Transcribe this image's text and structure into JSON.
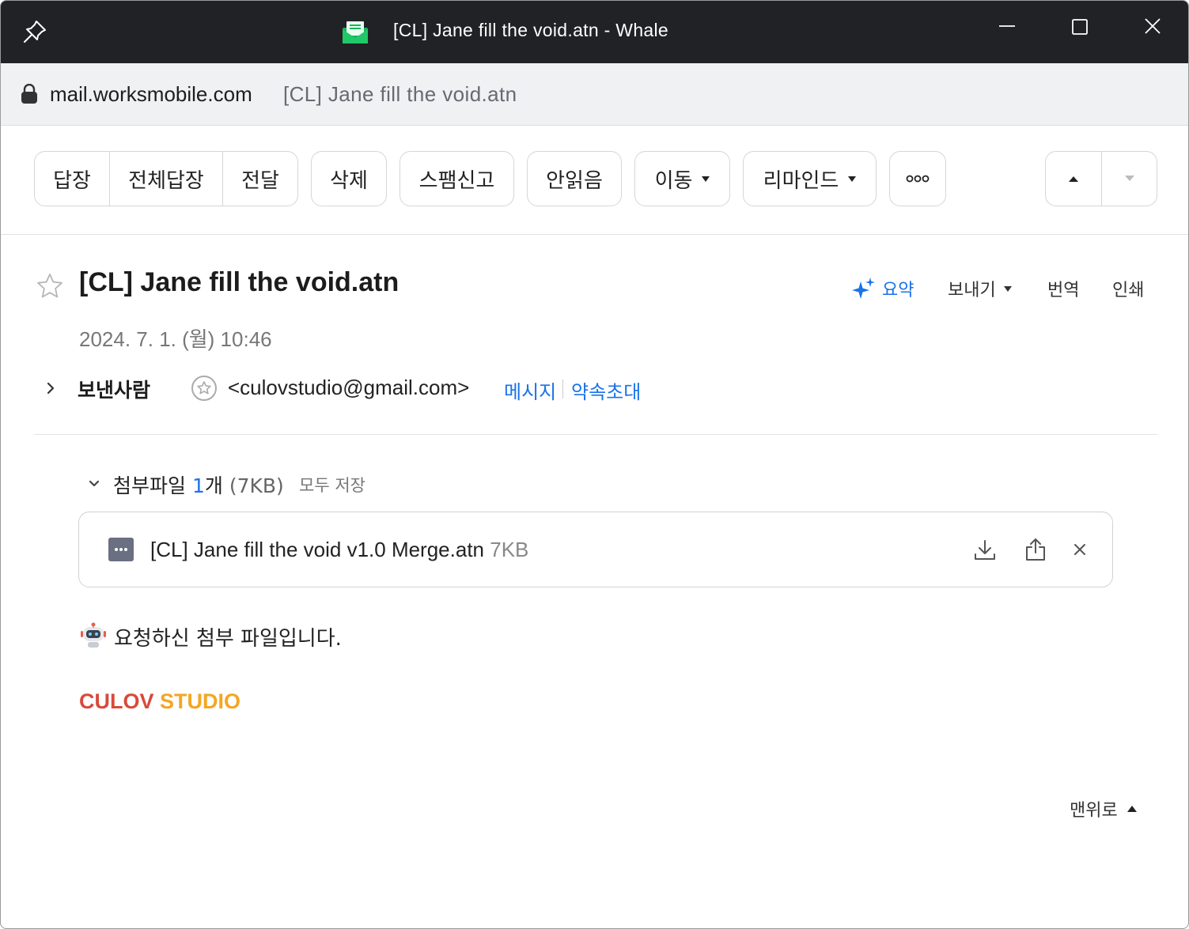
{
  "window": {
    "title": "[CL] Jane fill the void.atn - Whale"
  },
  "address": {
    "host": "mail.worksmobile.com",
    "page_title": "[CL] Jane fill the void.atn"
  },
  "toolbar": {
    "reply": "답장",
    "reply_all": "전체답장",
    "forward": "전달",
    "delete": "삭제",
    "report_spam": "스팸신고",
    "mark_unread": "안읽음",
    "move": "이동",
    "remind": "리마인드"
  },
  "mail": {
    "subject": "[CL] Jane fill the void.atn",
    "date": "2024. 7. 1. (월) 10:46",
    "actions": {
      "summary": "요약",
      "export": "보내기",
      "translate": "번역",
      "print": "인쇄"
    },
    "sender": {
      "label": "보낸사람",
      "email": "<culovstudio@gmail.com>",
      "message_link": "메시지",
      "invite_link": "약속초대"
    },
    "attachments": {
      "title_prefix": "첨부파일 ",
      "count": "1",
      "count_suffix": "개",
      "total_size": " (7KB)",
      "save_all": "모두 저장",
      "files": [
        {
          "name": "[CL] Jane fill the void v1.0 Merge.atn",
          "size": "7KB"
        }
      ]
    },
    "body": {
      "text": "요청하신 첨부 파일입니다.",
      "brand_part1": "CULOV",
      "brand_part2": " STUDIO"
    },
    "back_to_top": "맨위로"
  },
  "colors": {
    "titlebar": "#212226",
    "accent": "#1a73e8",
    "brand_red": "#d84a3a",
    "brand_orange": "#f5a623"
  }
}
